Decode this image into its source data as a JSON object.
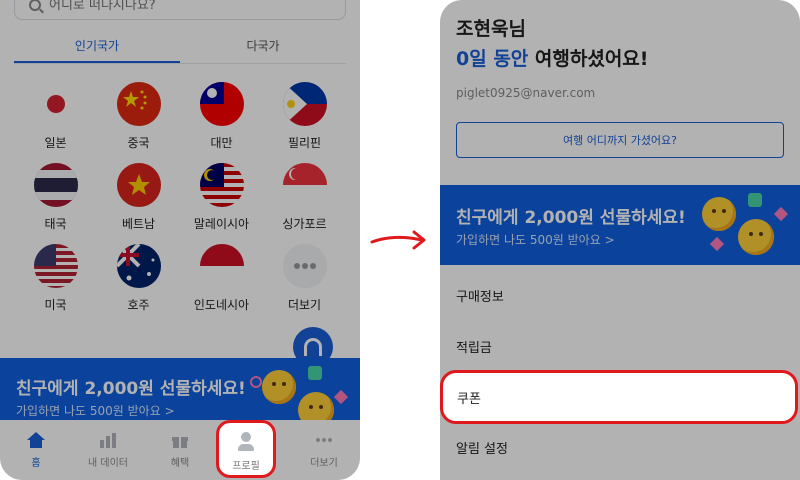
{
  "left_screen": {
    "search": {
      "placeholder": "어디로 떠나시나요?"
    },
    "tabs": [
      {
        "label": "인기국가",
        "active": true
      },
      {
        "label": "다국가",
        "active": false
      }
    ],
    "countries": [
      {
        "label": "일본",
        "icon": "japan-flag-icon"
      },
      {
        "label": "중국",
        "icon": "china-flag-icon"
      },
      {
        "label": "대만",
        "icon": "taiwan-flag-icon"
      },
      {
        "label": "필리핀",
        "icon": "philippines-flag-icon"
      },
      {
        "label": "태국",
        "icon": "thailand-flag-icon"
      },
      {
        "label": "베트남",
        "icon": "vietnam-flag-icon"
      },
      {
        "label": "말레이시아",
        "icon": "malaysia-flag-icon"
      },
      {
        "label": "싱가포르",
        "icon": "singapore-flag-icon"
      },
      {
        "label": "미국",
        "icon": "usa-flag-icon"
      },
      {
        "label": "호주",
        "icon": "australia-flag-icon"
      },
      {
        "label": "인도네시아",
        "icon": "indonesia-flag-icon"
      },
      {
        "label": "더보기",
        "icon": "more-dots-icon"
      }
    ],
    "banner": {
      "title": "친구에게 2,000원 선물하세요!",
      "subtitle": "가입하면 나도 500원 받아요 >"
    },
    "bottom_nav": [
      {
        "label": "홈",
        "icon": "home-icon",
        "active": true
      },
      {
        "label": "내 데이터",
        "icon": "bar-chart-icon",
        "active": false
      },
      {
        "label": "혜택",
        "icon": "gift-icon",
        "active": false
      },
      {
        "label": "프로필",
        "icon": "person-icon",
        "active": false
      },
      {
        "label": "더보기",
        "icon": "more-icon",
        "active": false
      }
    ]
  },
  "right_screen": {
    "name": "조현욱님",
    "days_highlight": "0일 동안",
    "days_rest": " 여행하셨어요!",
    "email": "piglet0925@naver.com",
    "travel_button": "여행 어디까지 가셨어요?",
    "banner": {
      "title": "친구에게 2,000원 선물하세요!",
      "subtitle": "가입하면 나도 500원 받아요 >"
    },
    "menu": [
      {
        "label": "구매정보"
      },
      {
        "label": "적립금"
      },
      {
        "label": "쿠폰"
      },
      {
        "label": "알림 설정"
      }
    ]
  },
  "colors": {
    "accent": "#1a5fd6",
    "banner": "#1160e0",
    "highlight": "#e0191f"
  }
}
